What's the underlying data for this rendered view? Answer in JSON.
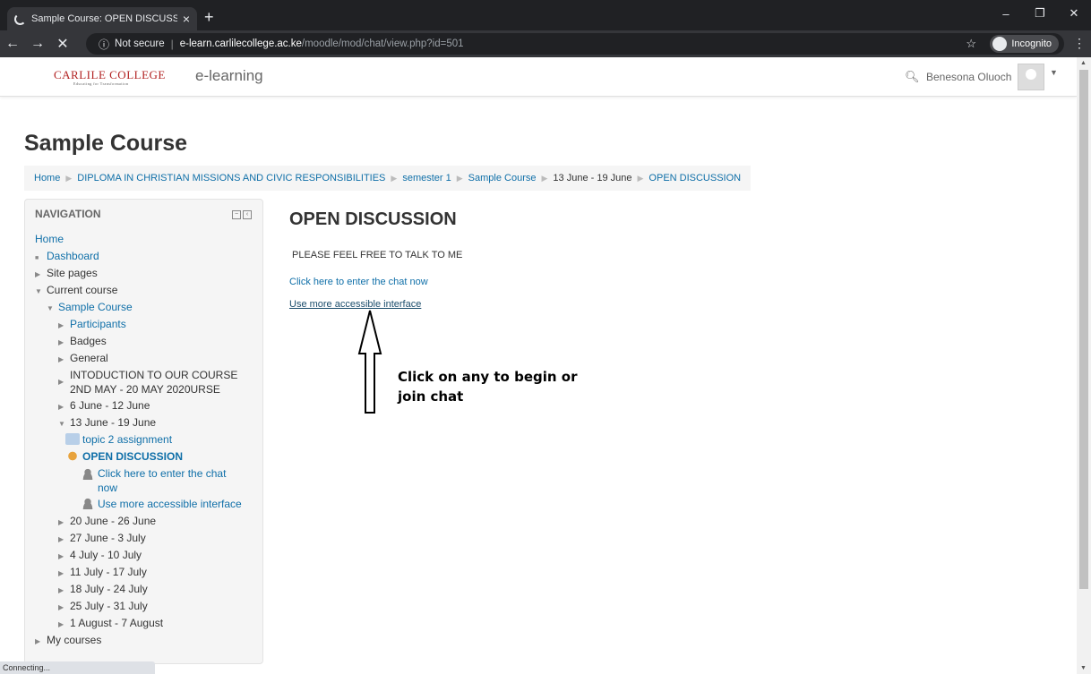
{
  "browser": {
    "tab_title": "Sample Course: OPEN DISCUSSIO",
    "tab_close": "×",
    "new_tab": "+",
    "back": "←",
    "forward": "→",
    "stop": "✕",
    "security_label": "Not secure",
    "url_host": "e-learn.carlilecollege.ac.ke",
    "url_path": "/moodle/mod/chat/view.php?id=501",
    "incognito_label": "Incognito",
    "status_text": "Connecting..."
  },
  "site": {
    "logo_text": "CARLILE COLLEGE",
    "logo_tagline": "Educating for Transformation",
    "brand": "e-learning",
    "user_name": "Benesona Oluoch"
  },
  "course": {
    "title": "Sample Course"
  },
  "breadcrumb": [
    "Home",
    "DIPLOMA IN CHRISTIAN MISSIONS AND CIVIC RESPONSIBILITIES",
    "semester 1",
    "Sample Course",
    "13 June - 19 June",
    "OPEN DISCUSSION"
  ],
  "navigation": {
    "heading": "NAVIGATION",
    "home": "Home",
    "dashboard": "Dashboard",
    "site_pages": "Site pages",
    "current_course": "Current course",
    "sample_course": "Sample Course",
    "participants": "Participants",
    "badges": "Badges",
    "general": "General",
    "intro_section": "INTODUCTION TO OUR COURSE 2ND MAY - 20 MAY 2020URSE",
    "week_6jun": "6 June - 12 June",
    "week_13jun": "13 June - 19 June",
    "topic2": "topic 2 assignment",
    "open_discussion": "OPEN DISCUSSION",
    "enter_chat": "Click here to enter the chat now",
    "accessible": "Use more accessible interface",
    "weeks_after": [
      "20 June - 26 June",
      "27 June - 3 July",
      "4 July - 10 July",
      "11 July - 17 July",
      "18 July - 24 July",
      "25 July - 31 July",
      "1 August - 7 August"
    ],
    "my_courses": "My courses"
  },
  "main": {
    "title": "OPEN DISCUSSION",
    "intro": "PLEASE FEEL FREE TO TALK TO ME",
    "enter_chat_link": "Click here to enter the chat now",
    "accessible_link": "Use more accessible interface",
    "annotation_line1": "Click on any to begin or",
    "annotation_line2": "join chat"
  }
}
